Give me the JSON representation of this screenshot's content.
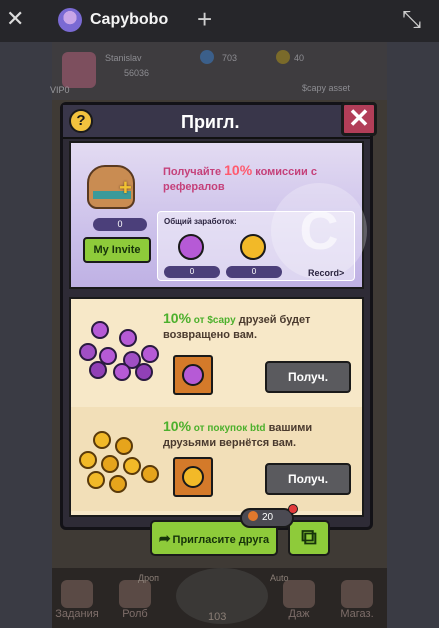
{
  "telegram": {
    "title": "Capybobo",
    "close_glyph": "✕",
    "new_tab_glyph": "+",
    "minimize_glyph": "⤡"
  },
  "game_bg": {
    "player_name": "Stanislav",
    "player_coins": "56036",
    "resource_1": "703",
    "resource_2": "40",
    "asset_label": "$capy asset",
    "vip_label": "VIP0"
  },
  "bottom_nav": {
    "items": [
      {
        "label": "Задания",
        "icon": "quest-icon"
      },
      {
        "label": "Ролб",
        "icon": "lock-icon"
      },
      {
        "label": "Даж",
        "icon": "lock-icon"
      },
      {
        "label": "Магаз.",
        "icon": "shop-icon"
      }
    ],
    "center_count": "103",
    "drop_label": "Дроп",
    "auto_label": "Auto"
  },
  "modal": {
    "title": "Пригл.",
    "help_glyph": "?",
    "close_glyph": "✕",
    "invite_count": "0",
    "my_invite_label": "My Invite",
    "banner_text_pre": "Получайте ",
    "banner_pct": "10%",
    "banner_text_post": " комиссии с рефералов",
    "earnings_label": "Общий заработок:",
    "earn_capy_value": "0",
    "earn_btd_value": "0",
    "record_label": "Record>",
    "rewards": [
      {
        "pct": "10%",
        "text_hl": " от $capy",
        "text_rest": " друзей будет возвращено вам.",
        "claim_label": "Получ."
      },
      {
        "pct": "10%",
        "text_hl": " от покупок btd",
        "text_rest": " вашими друзьями вернётся вам.",
        "claim_label": "Получ."
      }
    ],
    "invite_friend_label": "Пригласите друга",
    "energy_count": "20",
    "copy_glyph": "⧉"
  },
  "colors": {
    "accent_green": "#8ecb3a",
    "close_red": "#b23e58",
    "capy_coin": "#b65ad6",
    "btd_coin": "#f2b928",
    "pct_green": "#4cb02c",
    "banner_pink": "#c5417a"
  }
}
